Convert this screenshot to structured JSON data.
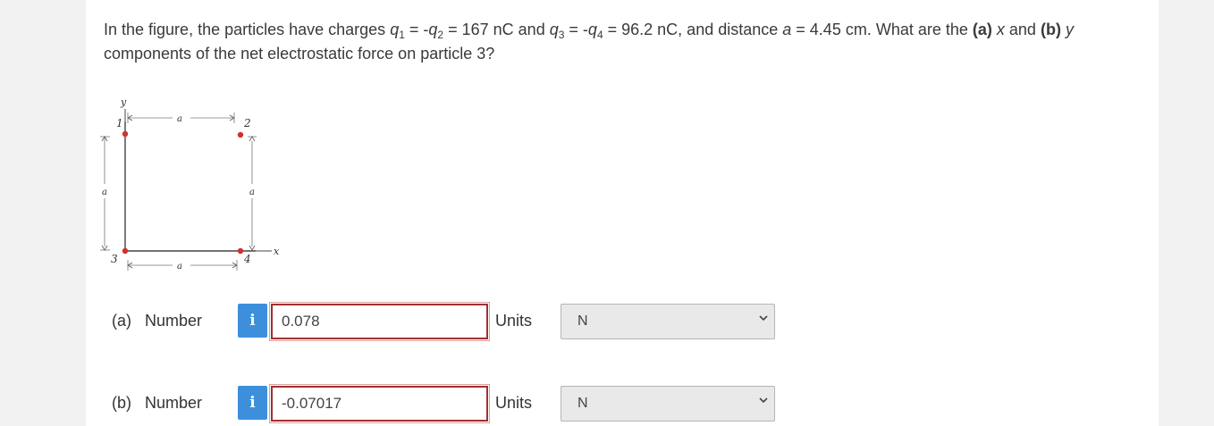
{
  "question": {
    "part1": "In the figure, the particles have charges ",
    "q1": "q",
    "q1_sub": "1",
    "eq1": " = -",
    "q2": "q",
    "q2_sub": "2",
    "eq2": " = 167 nC and ",
    "q3": "q",
    "q3_sub": "3",
    "eq3": " = -",
    "q4": "q",
    "q4_sub": "4",
    "eq4": " = 96.2 nC, and distance ",
    "a": "a",
    "eq5": " = 4.45 cm. What are the ",
    "pa": "(a)",
    "x": " x",
    "and": " and ",
    "pb": "(b)",
    "y": " y",
    "part2": "components of the net electrostatic force on particle 3?"
  },
  "figure": {
    "axis_y": "y",
    "axis_x": "x",
    "dim_a": "a",
    "p1": "1",
    "p2": "2",
    "p3": "3",
    "p4": "4",
    "particle_color": "#d03030"
  },
  "answers": [
    {
      "part": "(a)",
      "label": "Number",
      "info": "i",
      "value": "0.078",
      "units_label": "Units",
      "units": "N"
    },
    {
      "part": "(b)",
      "label": "Number",
      "info": "i",
      "value": "-0.07017",
      "units_label": "Units",
      "units": "N"
    }
  ],
  "colors": {
    "info_button": "#3d8fdc",
    "answer_border": "#a03030",
    "select_bg": "#e9e9e9"
  }
}
